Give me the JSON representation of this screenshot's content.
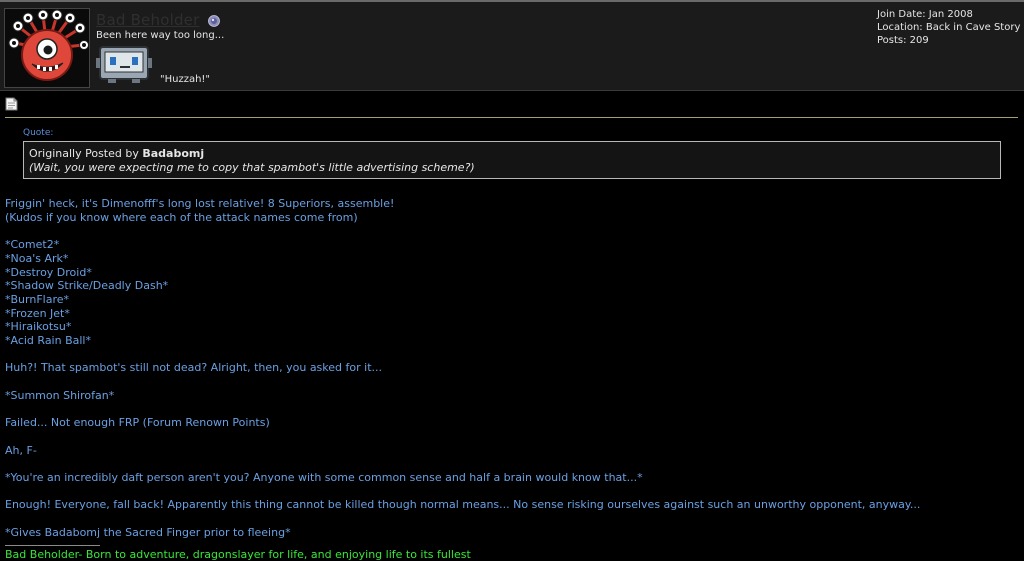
{
  "user": {
    "name": "Bad Beholder",
    "title": "Been here way too long...",
    "rank_caption": "\"Huzzah!\"",
    "avatar_icon": "beholder-avatar",
    "online_icon": "online-status-icon",
    "stats": {
      "join_date": "Join Date: Jan 2008",
      "location": "Location: Back in Cave Story",
      "posts": "Posts: 209"
    }
  },
  "post": {
    "icon": "post-icon",
    "quote": {
      "label": "Quote:",
      "prefix": "Originally Posted by ",
      "author": "Badabomj",
      "text": "(Wait, you were expecting me to copy that spambot's little advertising scheme?)"
    },
    "lines": [
      "Friggin' heck, it's Dimenofff's long lost relative! 8 Superiors, assemble!",
      "(Kudos if you know where each of the attack names come from)",
      "",
      "*Comet2*",
      "*Noa's Ark*",
      "*Destroy Droid*",
      "*Shadow Strike/Deadly Dash*",
      "*BurnFlare*",
      "*Frozen Jet*",
      "*Hiraikotsu*",
      "*Acid Rain Ball*",
      "",
      "Huh?! That spambot's still not dead? Alright, then, you asked for it...",
      "",
      "*Summon Shirofan*",
      "",
      "Failed... Not enough FRP (Forum Renown Points)",
      "",
      "Ah, F-",
      "",
      "*You're an incredibly daft person aren't you? Anyone with some common sense and half a brain would know that...*",
      "",
      "Enough! Everyone, fall back! Apparently this thing cannot be killed though normal means... No sense risking ourselves against such an unworthy opponent, anyway...",
      "",
      "*Gives Badabomj the Sacred Finger prior to fleeing*"
    ],
    "signature": "Bad Beholder- Born to adventure, dragonslayer for life, and enjoying life to its fullest"
  },
  "colors": {
    "background": "#000000",
    "header_bg": "#1b1b1b",
    "post_text": "#6aa0e2",
    "signature": "#39e639",
    "quote_label": "#5c8fd8"
  }
}
